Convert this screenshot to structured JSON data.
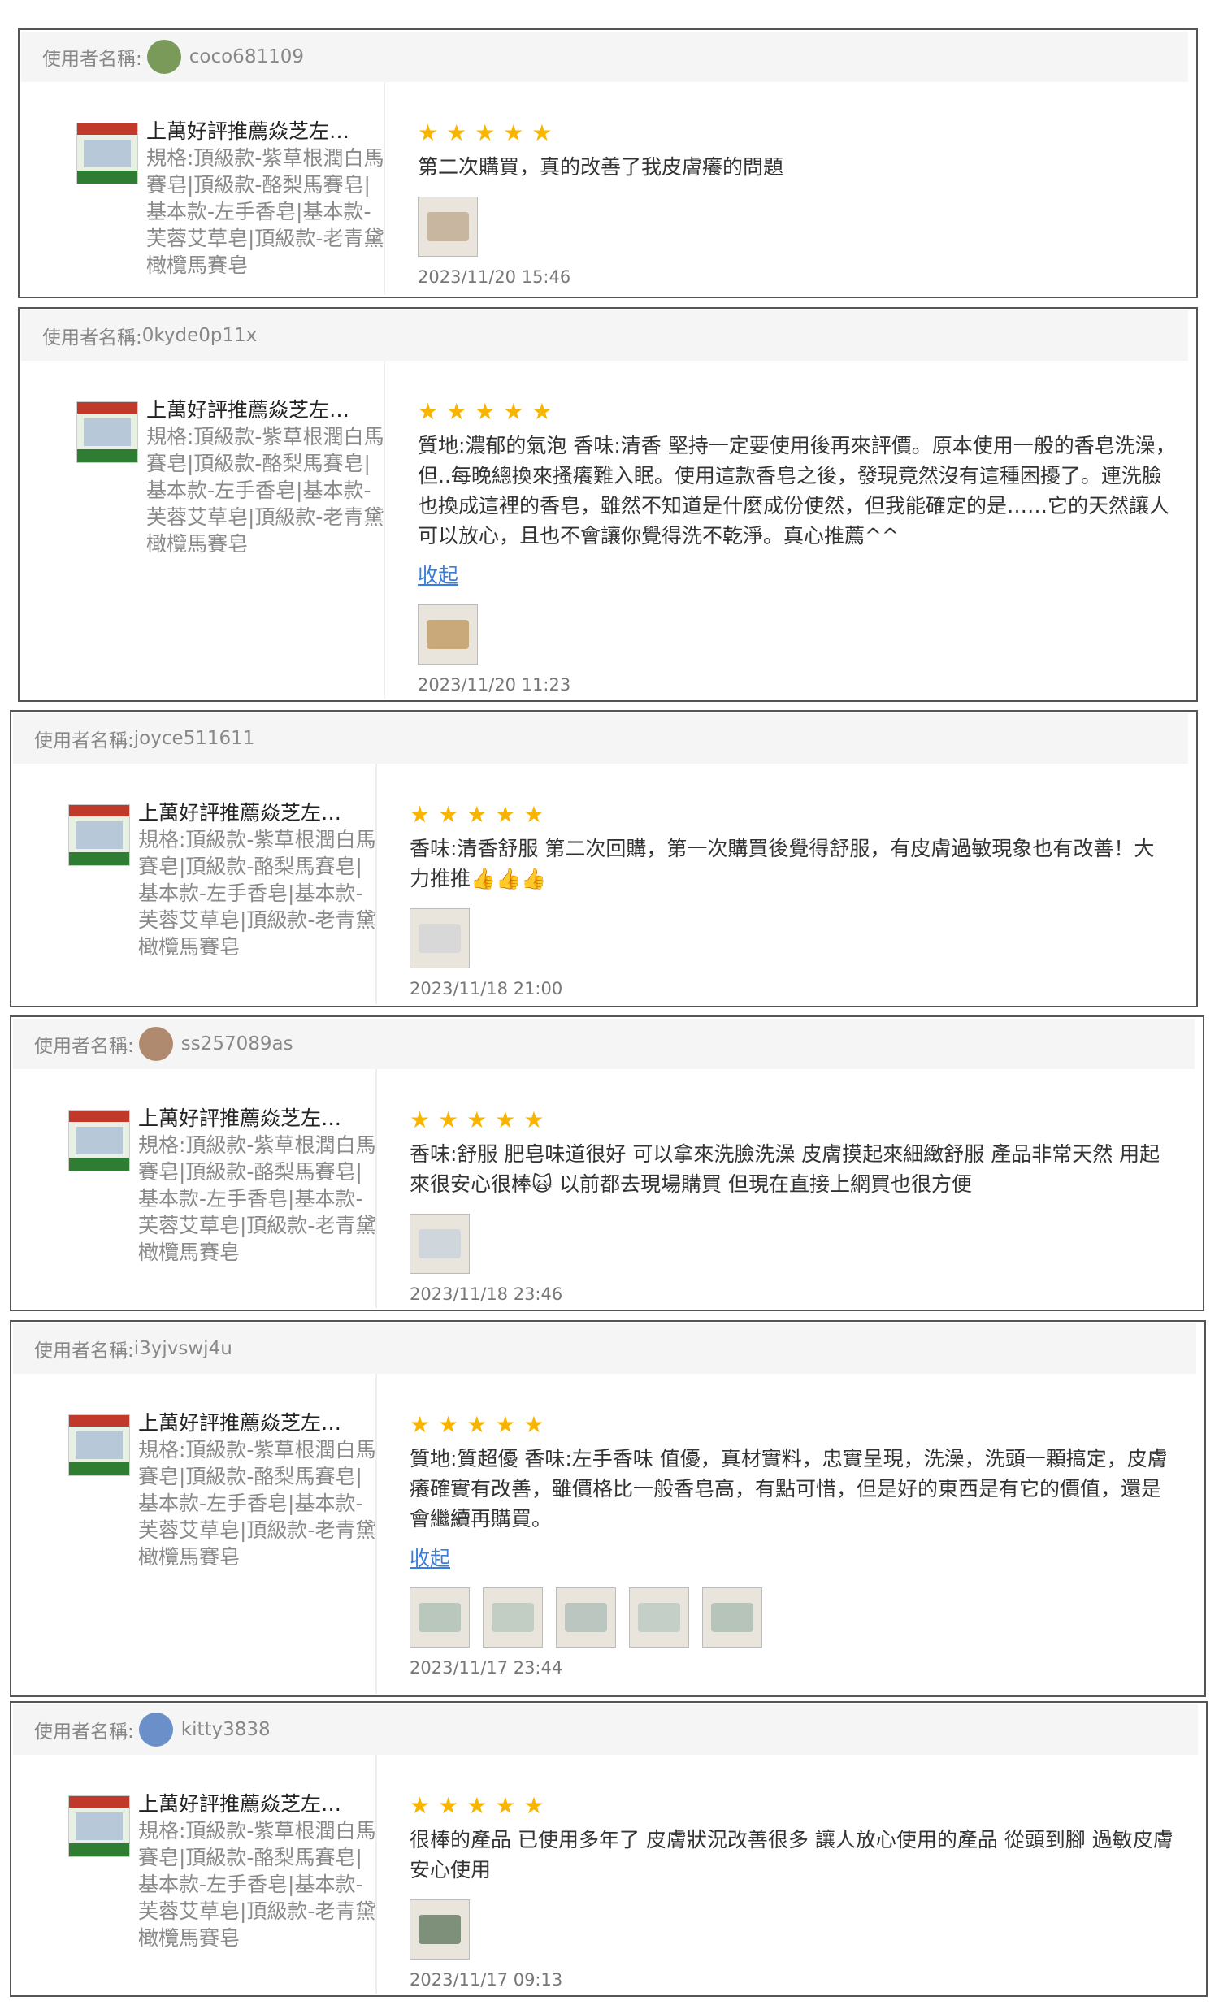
{
  "reviews": [
    {
      "user_label": "使用者名稱:",
      "username": "coco681109",
      "avatar_color": "#7a9a5a",
      "product_name": "上萬好評推薦焱芝左…",
      "product_spec": "規格:頂級款-紫草根潤白馬賽皂|頂級款-酪梨馬賽皂|基本款-左手香皂|基本款-芙蓉艾草皂|頂級款-老青黛橄欖馬賽皂",
      "stars": "★★★★★",
      "comment": "第二次購買，真的改善了我皮膚癢的問題",
      "collapse_label": "",
      "photo_colors": [
        "#c9b6a0"
      ],
      "date": "2023/11/20 15:46"
    },
    {
      "user_label": "使用者名稱:",
      "username": "0kyde0p11x",
      "avatar_color": "",
      "product_name": "上萬好評推薦焱芝左…",
      "product_spec": "規格:頂級款-紫草根潤白馬賽皂|頂級款-酪梨馬賽皂|基本款-左手香皂|基本款-芙蓉艾草皂|頂級款-老青黛橄欖馬賽皂",
      "stars": "★★★★★",
      "comment": "質地:濃郁的氣泡 香味:清香 堅持一定要使用後再來評價。原本使用一般的香皂洗澡，但..每晚總換來搔癢難入眠。使用這款香皂之後，發現竟然沒有這種困擾了。連洗臉也換成這裡的香皂，雖然不知道是什麼成份使然，但我能確定的是……它的天然讓人可以放心，且也不會讓你覺得洗不乾淨。真心推薦^^",
      "collapse_label": "收起",
      "photo_colors": [
        "#c9a97a"
      ],
      "date": "2023/11/20 11:23"
    },
    {
      "user_label": "使用者名稱:",
      "username": "joyce511611",
      "avatar_color": "",
      "product_name": "上萬好評推薦焱芝左…",
      "product_spec": "規格:頂級款-紫草根潤白馬賽皂|頂級款-酪梨馬賽皂|基本款-左手香皂|基本款-芙蓉艾草皂|頂級款-老青黛橄欖馬賽皂",
      "stars": "★★★★★",
      "comment": "香味:清香舒服 第二次回購，第一次購買後覺得舒服，有皮膚過敏現象也有改善！大力推推👍👍👍",
      "collapse_label": "",
      "photo_colors": [
        "#d8d8d8"
      ],
      "date": "2023/11/18 21:00"
    },
    {
      "user_label": "使用者名稱:",
      "username": "ss257089as",
      "avatar_color": "#b08a6e",
      "product_name": "上萬好評推薦焱芝左…",
      "product_spec": "規格:頂級款-紫草根潤白馬賽皂|頂級款-酪梨馬賽皂|基本款-左手香皂|基本款-芙蓉艾草皂|頂級款-老青黛橄欖馬賽皂",
      "stars": "★★★★★",
      "comment": "香味:舒服 肥皂味道很好 可以拿來洗臉洗澡 皮膚摸起來細緻舒服 產品非常天然 用起來很安心很棒🙀 以前都去現場購買 但現在直接上網買也很方便",
      "collapse_label": "",
      "photo_colors": [
        "#cfd6dc"
      ],
      "date": "2023/11/18 23:46"
    },
    {
      "user_label": "使用者名稱:",
      "username": "i3yjvswj4u",
      "avatar_color": "",
      "product_name": "上萬好評推薦焱芝左…",
      "product_spec": "規格:頂級款-紫草根潤白馬賽皂|頂級款-酪梨馬賽皂|基本款-左手香皂|基本款-芙蓉艾草皂|頂級款-老青黛橄欖馬賽皂",
      "stars": "★★★★★",
      "comment": "質地:質超優 香味:左手香味 值優，真材實料，忠實呈現，洗澡，洗頭一顆搞定，皮膚癢確實有改善，雖價格比一般香皂高，有點可惜，但是好的東西是有它的價值，還是會繼續再購買。",
      "collapse_label": "收起",
      "photo_colors": [
        "#b9c7bd",
        "#c2cec4",
        "#bac6bf",
        "#c4d0c7",
        "#b7c4ba"
      ],
      "date": "2023/11/17 23:44"
    },
    {
      "user_label": "使用者名稱:",
      "username": "kitty3838",
      "avatar_color": "#6b8fc9",
      "product_name": "上萬好評推薦焱芝左…",
      "product_spec": "規格:頂級款-紫草根潤白馬賽皂|頂級款-酪梨馬賽皂|基本款-左手香皂|基本款-芙蓉艾草皂|頂級款-老青黛橄欖馬賽皂",
      "stars": "★★★★★",
      "comment": "很棒的產品 已使用多年了 皮膚狀況改善很多 讓人放心使用的產品 從頭到腳 過敏皮膚安心使用",
      "collapse_label": "",
      "photo_colors": [
        "#7e8f7a"
      ],
      "date": "2023/11/17 09:13"
    }
  ]
}
